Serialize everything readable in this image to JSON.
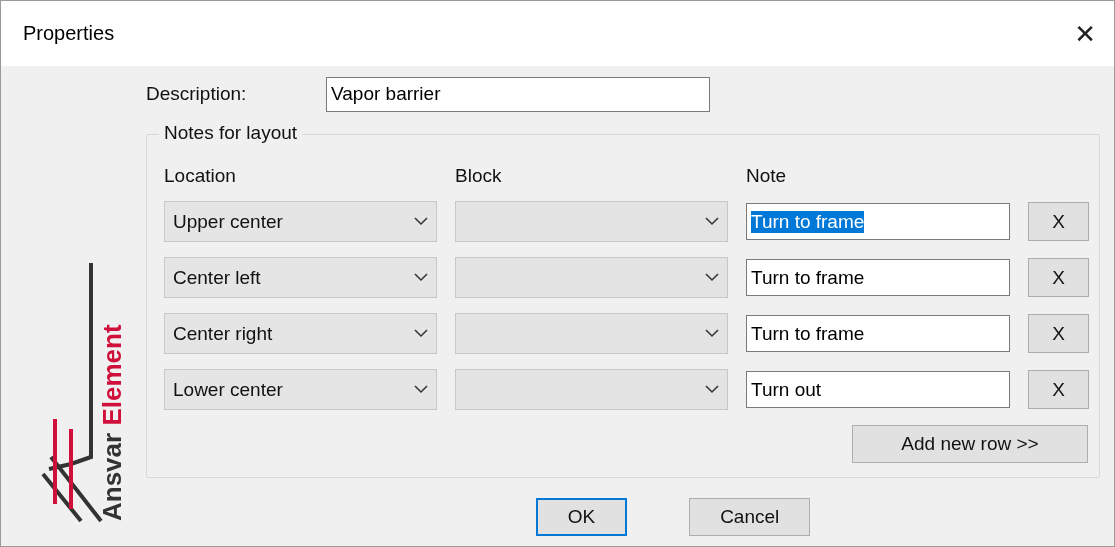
{
  "window": {
    "title": "Properties",
    "close": "✕"
  },
  "logo": {
    "primary": "Ansvar",
    "secondary": "Element"
  },
  "description": {
    "label": "Description:",
    "value": "Vapor barrier"
  },
  "group": {
    "title": "Notes for layout",
    "columns": [
      "Location",
      "Block",
      "Note"
    ],
    "rows": [
      {
        "location": "Upper center",
        "block_disabled": true,
        "note": "Turn to frame",
        "note_selected": true,
        "remove": "X"
      },
      {
        "location": "Center left",
        "block_disabled": true,
        "note": "Turn to frame",
        "note_selected": false,
        "remove": "X"
      },
      {
        "location": "Center right",
        "block_disabled": true,
        "note": "Turn to frame",
        "note_selected": false,
        "remove": "X"
      },
      {
        "location": "Lower center",
        "block_disabled": true,
        "note": "Turn out",
        "note_selected": false,
        "remove": "X"
      }
    ],
    "add_button": "Add new row >>"
  },
  "buttons": [
    {
      "label": "OK",
      "default": true
    },
    {
      "label": "Cancel",
      "default": false
    }
  ]
}
